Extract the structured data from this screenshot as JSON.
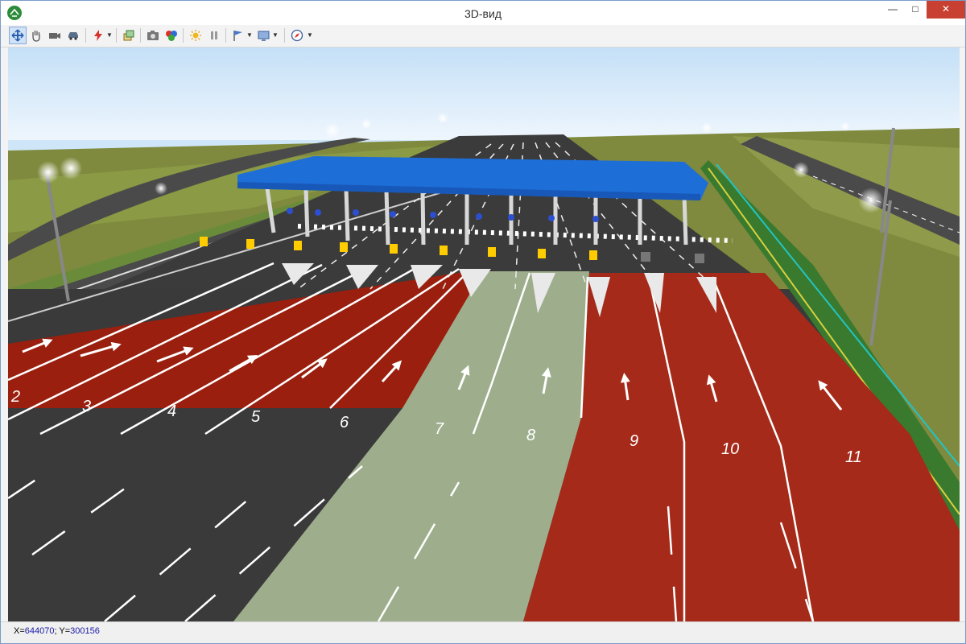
{
  "window": {
    "title": "3D-вид",
    "minimize_glyph": "—",
    "maximize_glyph": "□",
    "close_glyph": "✕"
  },
  "toolbar": {
    "buttons": [
      {
        "icon": "move-icon",
        "active": true
      },
      {
        "icon": "hand-icon"
      },
      {
        "icon": "camera-view-icon"
      },
      {
        "icon": "car-icon"
      },
      {
        "icon": "lightning-icon",
        "dropdown": true
      },
      {
        "icon": "layers-icon"
      },
      {
        "icon": "photo-camera-icon"
      },
      {
        "icon": "color-palette-icon"
      },
      {
        "icon": "sun-icon"
      },
      {
        "icon": "pause-icon"
      },
      {
        "icon": "flag-icon",
        "dropdown": true
      },
      {
        "icon": "screen-export-icon",
        "dropdown": true
      },
      {
        "icon": "compass-icon",
        "dropdown": true
      }
    ]
  },
  "scene": {
    "lane_numbers": [
      "2",
      "3",
      "4",
      "5",
      "6",
      "7",
      "8",
      "9",
      "10",
      "11"
    ],
    "colors": {
      "sky": "#cfe6f8",
      "grass": "#7d8a3a",
      "asphalt": "#3a3a3a",
      "red_lane": "#a8281a",
      "green_lane": "#9fb08e",
      "canopy": "#1e6ed8"
    }
  },
  "status": {
    "x_label": "X=",
    "x_value": "644070",
    "sep": "; ",
    "y_label": "Y=",
    "y_value": "300156"
  }
}
